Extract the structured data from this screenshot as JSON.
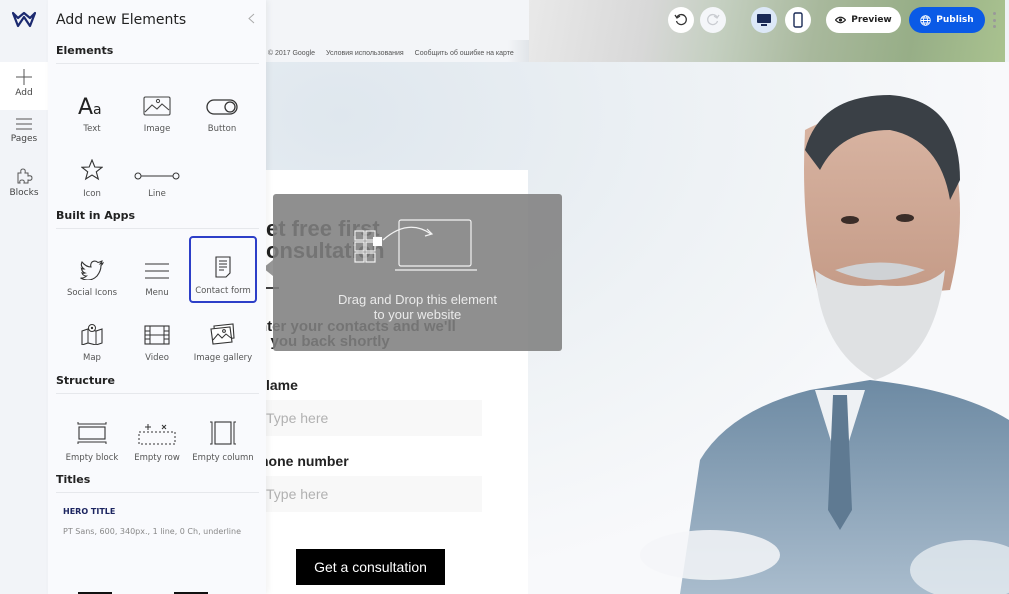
{
  "panel": {
    "title": "Add new Elements",
    "close_icon": "chevron-left-icon",
    "sections": {
      "elements": {
        "title": "Elements",
        "items": [
          {
            "label": "Text",
            "icon": "text-icon"
          },
          {
            "label": "Image",
            "icon": "image-icon"
          },
          {
            "label": "Button",
            "icon": "toggle-button-icon"
          },
          {
            "label": "Icon",
            "icon": "star-icon"
          },
          {
            "label": "Line",
            "icon": "line-icon"
          }
        ]
      },
      "apps": {
        "title": "Built in Apps",
        "items": [
          {
            "label": "Social Icons",
            "icon": "twitter-bird-icon"
          },
          {
            "label": "Menu",
            "icon": "hamburger-menu-icon"
          },
          {
            "label": "Contact form",
            "icon": "document-icon",
            "selected": true
          },
          {
            "label": "Map",
            "icon": "map-icon"
          },
          {
            "label": "Video",
            "icon": "film-icon"
          },
          {
            "label": "Image gallery",
            "icon": "gallery-icon"
          }
        ]
      },
      "structure": {
        "title": "Structure",
        "items": [
          {
            "label": "Empty block",
            "icon": "empty-block-icon"
          },
          {
            "label": "Empty row",
            "icon": "empty-row-icon"
          },
          {
            "label": "Empty column",
            "icon": "empty-column-icon"
          }
        ]
      },
      "titles": {
        "title": "Titles",
        "hero": {
          "name": "HERO TITLE",
          "desc": "PT Sans, 600, 340px., 1 line, 0 Ch, underline"
        }
      }
    }
  },
  "rail": {
    "logo": "wix-crown-logo",
    "items": [
      {
        "label": "Add",
        "icon": "plus-icon",
        "active": true
      },
      {
        "label": "Pages",
        "icon": "hamburger-icon"
      },
      {
        "label": "Blocks",
        "icon": "puzzle-icon"
      }
    ]
  },
  "toolbar": {
    "undo_icon": "undo-icon",
    "redo_icon": "redo-icon",
    "desktop_icon": "desktop-icon",
    "mobile_icon": "mobile-icon",
    "preview_label": "Preview",
    "publish_label": "Publish",
    "publish_color": "#0a5ae6",
    "device_active": "desktop"
  },
  "map": {
    "attribution": [
      "е © 2017 Google",
      "Условия использования",
      "Сообщить об ошибке на карте"
    ]
  },
  "form": {
    "title": "Get free first\nconsultation",
    "title_visible": "et free first\nonsultation",
    "subtitle_visible": "nter your contacts and we'll\nll you back shortly",
    "fields": [
      {
        "label_visible": "lame",
        "placeholder": "Type here"
      },
      {
        "label_visible": "hone number",
        "placeholder": "Type here"
      }
    ],
    "cta_label": "Get a consultation"
  },
  "drag_tooltip": {
    "text_line1": "Drag and Drop this element",
    "text_line2": "to your website"
  }
}
